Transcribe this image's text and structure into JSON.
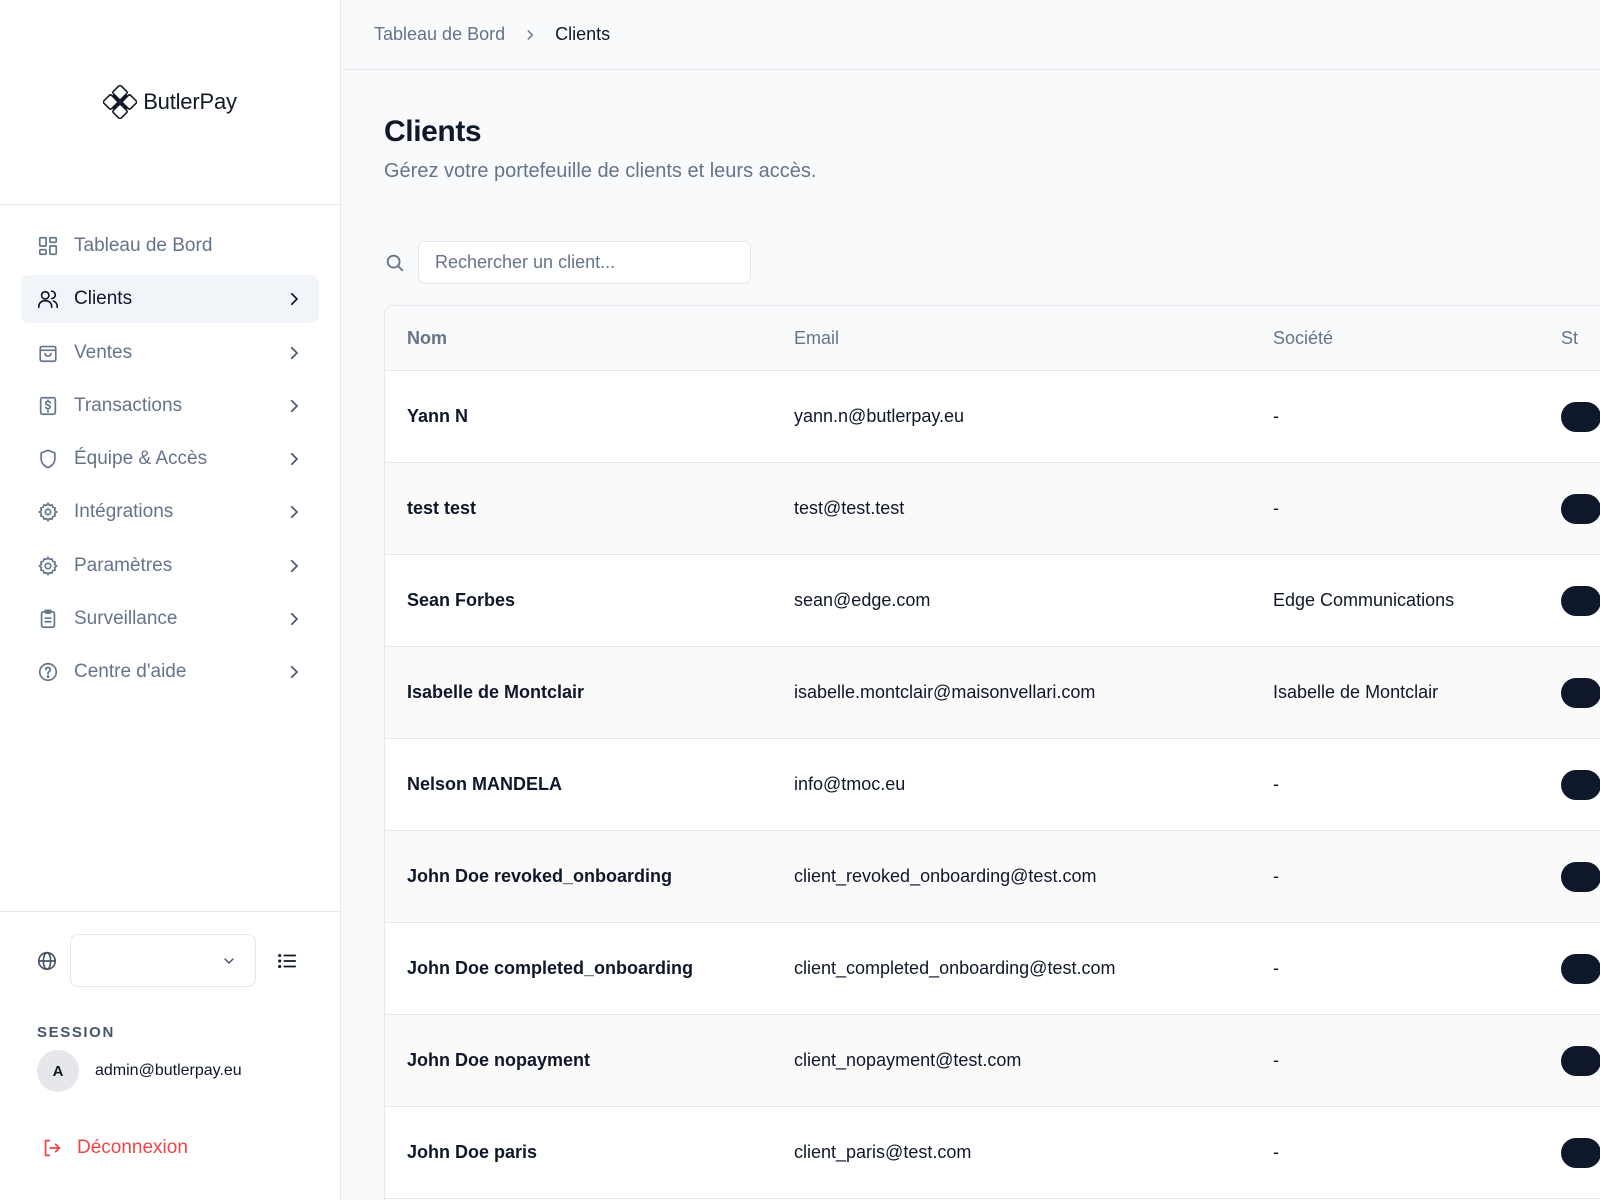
{
  "brand": {
    "name": "ButlerPay"
  },
  "breadcrumb": {
    "home": "Tableau de Bord",
    "current": "Clients"
  },
  "sidebar": {
    "items": [
      {
        "label": "Tableau de Bord",
        "icon": "dashboard-icon",
        "active": false,
        "chevron": false
      },
      {
        "label": "Clients",
        "icon": "users-icon",
        "active": true,
        "chevron": true
      },
      {
        "label": "Ventes",
        "icon": "shopping-bag-icon",
        "active": false,
        "chevron": true
      },
      {
        "label": "Transactions",
        "icon": "receipt-dollar-icon",
        "active": false,
        "chevron": true
      },
      {
        "label": "Équipe & Accès",
        "icon": "shield-icon",
        "active": false,
        "chevron": true
      },
      {
        "label": "Intégrations",
        "icon": "gear-icon",
        "active": false,
        "chevron": true
      },
      {
        "label": "Paramètres",
        "icon": "gear-icon",
        "active": false,
        "chevron": true
      },
      {
        "label": "Surveillance",
        "icon": "clipboard-icon",
        "active": false,
        "chevron": true
      },
      {
        "label": "Centre d'aide",
        "icon": "help-circle-icon",
        "active": false,
        "chevron": true
      }
    ],
    "footer": {
      "language_value": "",
      "session_label": "SESSION",
      "user_initial": "A",
      "user_email": "admin@butlerpay.eu",
      "logout_label": "Déconnexion"
    }
  },
  "page": {
    "title": "Clients",
    "subtitle": "Gérez votre portefeuille de clients et leurs accès."
  },
  "search": {
    "placeholder": "Rechercher un client...",
    "value": ""
  },
  "table": {
    "headers": {
      "name": "Nom",
      "email": "Email",
      "company": "Société",
      "status": "St"
    },
    "rows": [
      {
        "name": "Yann N",
        "email": "yann.n@butlerpay.eu",
        "company": "-"
      },
      {
        "name": "test test",
        "email": "test@test.test",
        "company": "-"
      },
      {
        "name": "Sean Forbes",
        "email": "sean@edge.com",
        "company": "Edge Communications"
      },
      {
        "name": "Isabelle de Montclair",
        "email": "isabelle.montclair@maisonvellari.com",
        "company": "Isabelle de Montclair"
      },
      {
        "name": "Nelson MANDELA",
        "email": "info@tmoc.eu",
        "company": "-"
      },
      {
        "name": "John Doe revoked_onboarding",
        "email": "client_revoked_onboarding@test.com",
        "company": "-"
      },
      {
        "name": "John Doe completed_onboarding",
        "email": "client_completed_onboarding@test.com",
        "company": "-"
      },
      {
        "name": "John Doe nopayment",
        "email": "client_nopayment@test.com",
        "company": "-"
      },
      {
        "name": "John Doe paris",
        "email": "client_paris@test.com",
        "company": "-"
      }
    ]
  },
  "colors": {
    "accent_dark": "#0f172a",
    "muted_text": "#64748b",
    "danger": "#ef4444",
    "border": "#e5e7eb",
    "active_nav_bg": "#f1f5f9"
  }
}
